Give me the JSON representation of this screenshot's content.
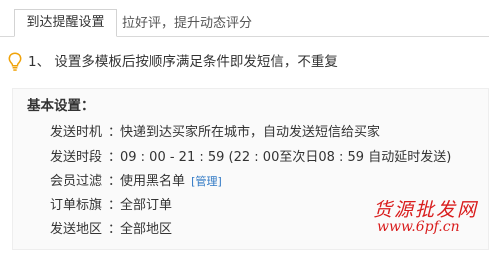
{
  "tabs": [
    {
      "label": "到达提醒设置",
      "active": true
    },
    {
      "label": "拉好评，提升动态评分",
      "active": false
    }
  ],
  "notice": {
    "icon": "lightbulb-icon",
    "text": "1、 设置多模板后按顺序满足条件即发短信，不重复"
  },
  "settings": {
    "title": "基本设置：",
    "rows": [
      {
        "label": "发送时机",
        "colon": "：",
        "value": "快递到达买家所在城市，自动发送短信给买家"
      },
      {
        "label": "发送时段",
        "colon": "：",
        "value": "09 : 00 - 21 : 59 (22 : 00至次日08 : 59 自动延时发送)"
      },
      {
        "label": "会员过滤",
        "colon": "：",
        "value": "使用黑名单",
        "link": "[管理]"
      },
      {
        "label": "订单标旗",
        "colon": "：",
        "value": "全部订单"
      },
      {
        "label": "发送地区",
        "colon": "：",
        "value": "全部地区"
      }
    ]
  },
  "watermark": {
    "cn": "货源批发网",
    "url": "www.6pf.cn"
  },
  "colors": {
    "link": "#2f78c4",
    "watermark": "#d91d1d",
    "bulb": "#f0a30a",
    "panel_bg": "#fafafa"
  }
}
